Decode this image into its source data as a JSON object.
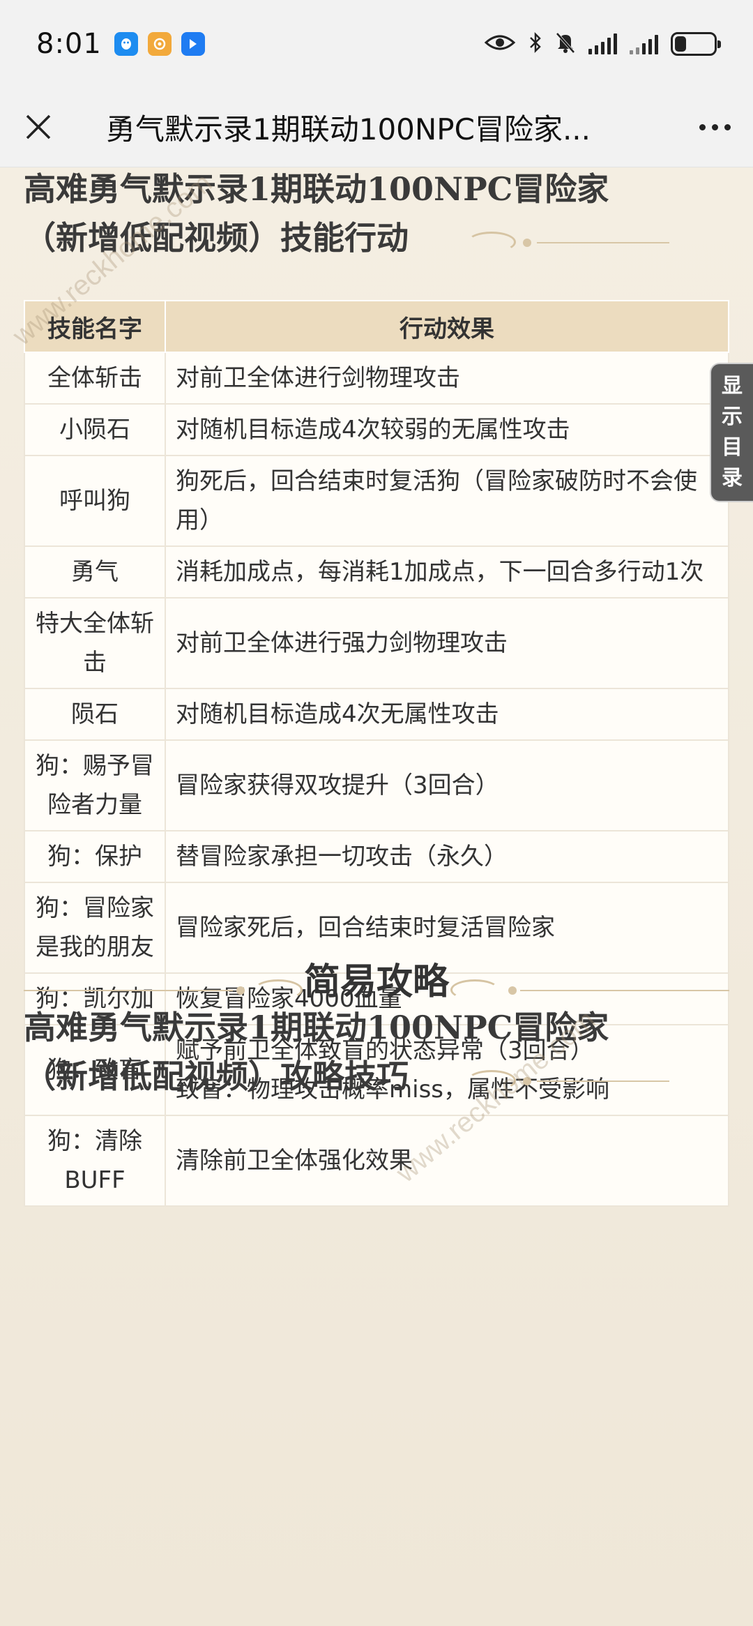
{
  "status_bar": {
    "time": "8:01",
    "apps": [
      "qq-app-icon",
      "weibo-app-icon",
      "lark-app-icon"
    ],
    "battery_level": 0.3
  },
  "title_bar": {
    "title": "勇气默示录1期联动100NPC冒险家..."
  },
  "article": {
    "heading_top_line1": "高难勇气默示录1期联动100NPC冒险家",
    "heading_top_line2": "（新增低配视频）技能行动",
    "table": {
      "headers": [
        "技能名字",
        "行动效果"
      ],
      "rows": [
        {
          "name": "全体斩击",
          "effect": "对前卫全体进行剑物理攻击"
        },
        {
          "name": "小陨石",
          "effect": "对随机目标造成4次较弱的无属性攻击"
        },
        {
          "name": "呼叫狗",
          "effect": "狗死后，回合结束时复活狗（冒险家破防时不会使用）"
        },
        {
          "name": "勇气",
          "effect": "消耗加成点，每消耗1加成点，下一回合多行动1次"
        },
        {
          "name": "特大全体斩击",
          "effect": "对前卫全体进行强力剑物理攻击"
        },
        {
          "name": "陨石",
          "effect": "对随机目标造成4次无属性攻击"
        },
        {
          "name": "狗：赐予冒险者力量",
          "effect": "冒险家获得双攻提升（3回合）"
        },
        {
          "name": "狗：保护",
          "effect": "替冒险家承担一切攻击（永久）"
        },
        {
          "name": "狗：冒险家是我的朋友",
          "effect": "冒险家死后，回合结束时复活冒险家"
        },
        {
          "name": "狗：凯尔加",
          "effect": "恢复冒险家4000血量"
        },
        {
          "name": "狗：致盲",
          "effect": "赋予前卫全体致盲的状态异常（3回合）\n致盲：物理攻击概率miss，属性不受影响"
        },
        {
          "name": "狗：清除BUFF",
          "effect": "清除前卫全体强化效果"
        }
      ]
    },
    "toc_label": "显示目录",
    "section_title": "简易攻略",
    "heading_bottom_line1": "高难勇气默示录1期联动100NPC冒险家",
    "heading_bottom_line2": "（新增低配视频）攻略技巧",
    "watermark": "www.reckhome.com"
  },
  "colors": {
    "page_bg": "#f3ecdf",
    "table_header_bg": "#ecdcbf",
    "toc_bg": "#5a5a5a"
  }
}
